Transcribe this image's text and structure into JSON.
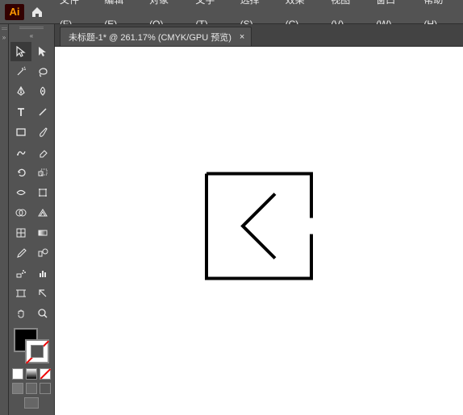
{
  "app": {
    "badge": "Ai"
  },
  "menu": {
    "file": "文件(F)",
    "edit": "编辑(E)",
    "object": "对象(O)",
    "type": "文字(T)",
    "select": "选择(S)",
    "effect": "效果(C)",
    "view": "视图(V)",
    "window": "窗口(W)",
    "help": "帮助(H)"
  },
  "tab": {
    "label": "未标题-1* @ 261.17%  (CMYK/GPU 预览)",
    "close": "×"
  },
  "tools": {
    "selection": "selection",
    "direct_selection": "direct-selection",
    "magic_wand": "magic-wand",
    "lasso": "lasso",
    "pen": "pen",
    "curvature": "curvature",
    "type": "type",
    "line": "line",
    "rectangle": "rectangle",
    "paintbrush": "paintbrush",
    "shaper": "shaper",
    "eraser": "eraser",
    "rotate": "rotate",
    "scale": "scale",
    "width": "width",
    "free_transform": "free-transform",
    "shape_builder": "shape-builder",
    "perspective": "perspective",
    "mesh": "mesh",
    "gradient": "gradient",
    "eyedropper": "eyedropper",
    "blend": "blend",
    "symbol_sprayer": "symbol-sprayer",
    "column_graph": "column-graph",
    "artboard": "artboard",
    "slice": "slice",
    "hand": "hand",
    "zoom": "zoom"
  },
  "colors": {
    "fill": "#000000",
    "stroke": "none"
  },
  "screen_modes": {
    "normal": "normal"
  }
}
